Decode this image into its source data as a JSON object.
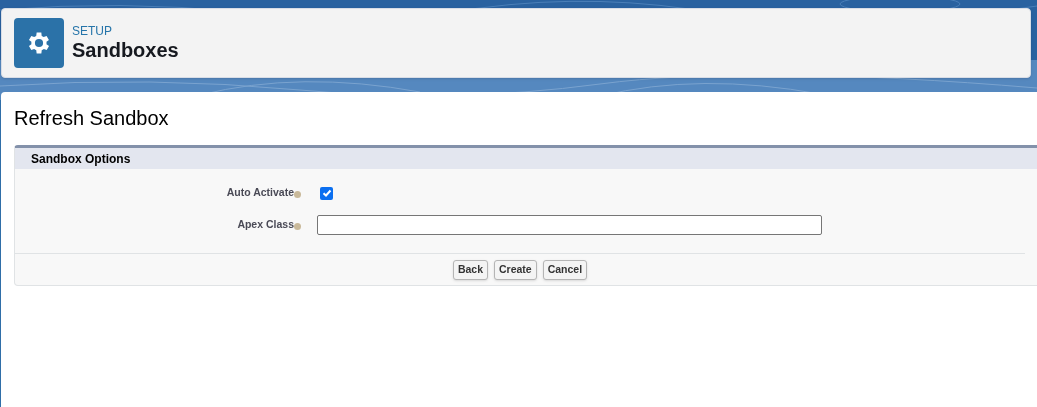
{
  "header": {
    "eyebrow": "SETUP",
    "title": "Sandboxes"
  },
  "page_title": "Refresh Sandbox",
  "section": {
    "title": "Sandbox Options",
    "fields": [
      {
        "kind": "checkbox",
        "label": "Auto Activate",
        "checked": true
      },
      {
        "kind": "text",
        "label": "Apex Class"
      }
    ]
  },
  "buttons": [
    "Back",
    "Create",
    "Cancel"
  ]
}
